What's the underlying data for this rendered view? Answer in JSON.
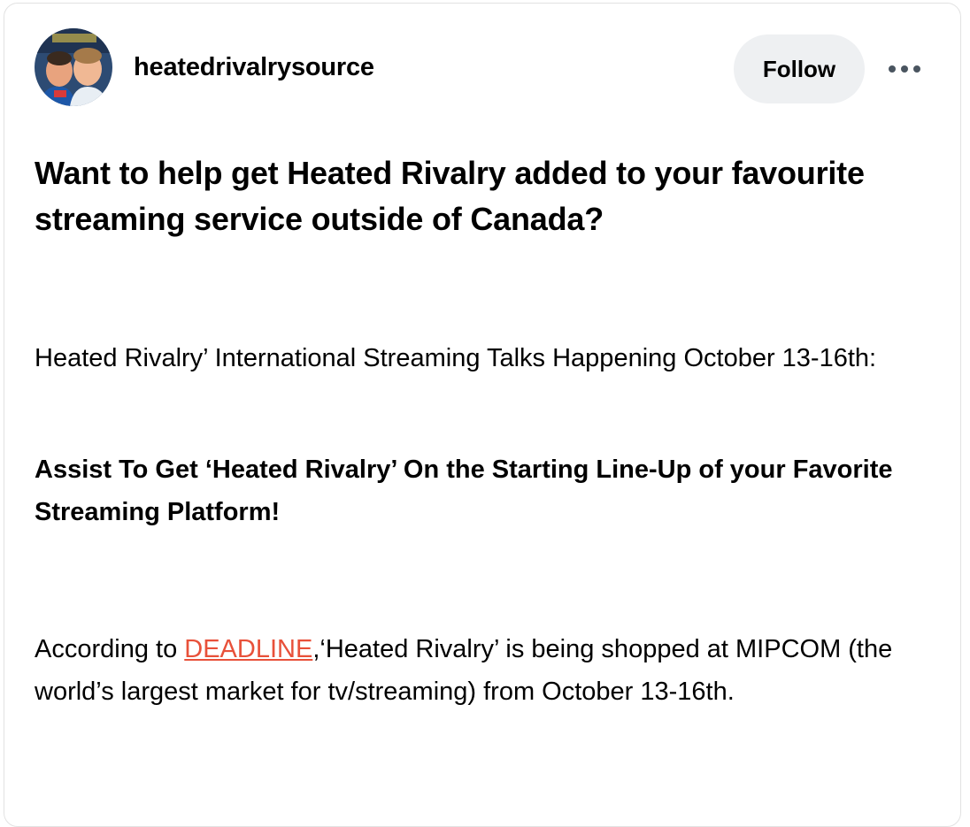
{
  "post": {
    "author": {
      "username": "heatedrivalrysource",
      "avatar_icon": "avatar-photo"
    },
    "follow_label": "Follow",
    "more_icon": "more-horizontal-icon",
    "title": "Want to help get Heated Rivalry added to your favourite streaming service outside of Canada?",
    "body": {
      "p1": "Heated Rivalry’ International Streaming Talks Happening October 13-16th:",
      "p2": "Assist To Get ‘Heated Rivalry’ On the Starting Line-Up of your Favorite Streaming Platform!",
      "p3_prefix": "According to ",
      "p3_link": "DEADLINE",
      "p3_suffix": ",‘Heated Rivalry’ is being shopped at MIPCOM (the world’s largest market for tv/streaming) from October 13-16th."
    }
  },
  "colors": {
    "link": "#e8513a",
    "follow_bg": "#eef0f2",
    "border": "#e2e2e2"
  }
}
